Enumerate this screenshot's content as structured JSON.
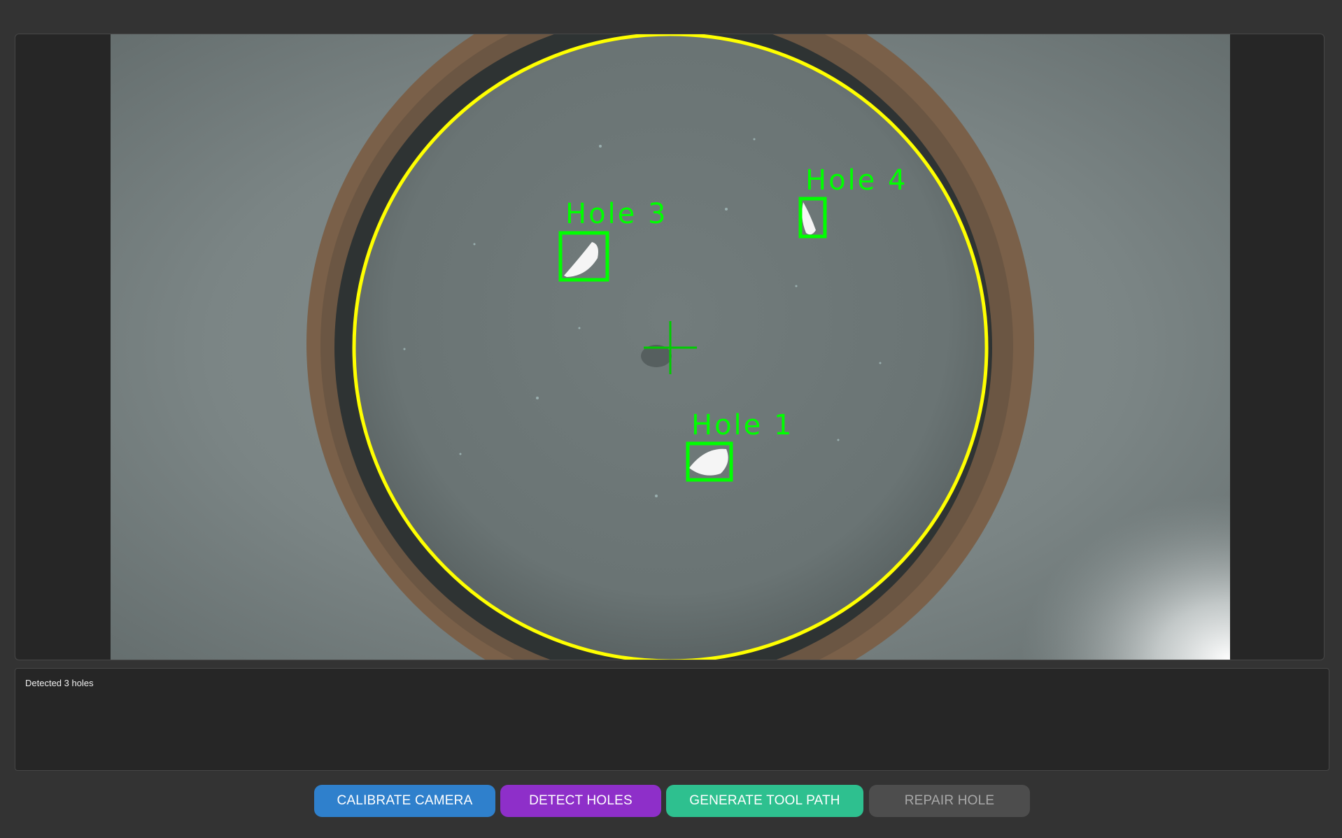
{
  "camera": {
    "holes": [
      {
        "label": "Hole 3"
      },
      {
        "label": "Hole 4"
      },
      {
        "label": "Hole 1"
      }
    ],
    "colors": {
      "boundary_circle": "#ffff00",
      "detection": "#00ff00"
    }
  },
  "log": {
    "lines": [
      "Detected 3 holes"
    ]
  },
  "toolbar": {
    "calibrate_label": "CALIBRATE CAMERA",
    "detect_label": "DETECT HOLES",
    "toolpath_label": "GENERATE TOOL PATH",
    "repair_label": "REPAIR HOLE"
  },
  "colors": {
    "background": "#333333",
    "panel": "#262626",
    "calibrate": "#2f80cc",
    "detect": "#8e2fc9",
    "toolpath": "#2ec08f",
    "repair_disabled": "#4d4d4d"
  }
}
